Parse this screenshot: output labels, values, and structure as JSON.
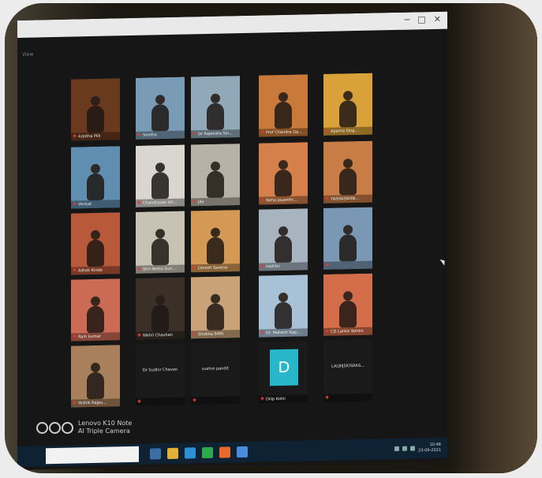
{
  "window": {
    "minimize_glyph": "─",
    "maximize_glyph": "□",
    "close_glyph": "✕",
    "menu_label": "View"
  },
  "participants": [
    {
      "name": "Arpitha Pilli",
      "bg": "#6a3a1e"
    },
    {
      "name": "Smitha",
      "bg": "#7a9bb5"
    },
    {
      "name": "Dr Rajendra Sin...",
      "bg": "#90a8b8"
    },
    {
      "name": "Prof Chandra Ga...",
      "bg": "#c97a3a"
    },
    {
      "name": "Aparna Sing...",
      "bg": "#d9a13a"
    },
    {
      "name": "Venkat",
      "bg": "#5f8eb0"
    },
    {
      "name": "Chandrasan Alt...",
      "bg": "#d8d6cf"
    },
    {
      "name": "Jay",
      "bg": "#b7b2a6"
    },
    {
      "name": "Neha Jayanthi...",
      "bg": "#d5804a"
    },
    {
      "name": "YASHASWINI...",
      "bg": "#c77d45"
    },
    {
      "name": "Ashok Kinde",
      "bg": "#b85a3a"
    },
    {
      "name": "Shri Neela Suri...",
      "bg": "#c8c2b4"
    },
    {
      "name": "Dinesh Saxena",
      "bg": "#d49a55"
    },
    {
      "name": "HARSH",
      "bg": "#a7b4c0"
    },
    {
      "name": "",
      "bg": "#7a98b3"
    },
    {
      "name": "Ram kumar",
      "bg": "#cc6b55"
    },
    {
      "name": "Nikhil Chauhan",
      "bg": "#3a3028"
    },
    {
      "name": "Shobha SHRI",
      "bg": "#c9a278"
    },
    {
      "name": "Dr. Mahesh Kap...",
      "bg": "#a9c1d6"
    },
    {
      "name": "CD Lanka Yamini",
      "bg": "#d46e4a"
    },
    {
      "name": "Yeshik Rajpu...",
      "bg": "#a8805c"
    }
  ],
  "text_tiles": [
    {
      "center": "Dr Sudhir Cheven",
      "name": ""
    },
    {
      "center": "sushm pandit",
      "name": ""
    },
    {
      "center": "",
      "name": "Dilip Kohli",
      "avatar_letter": "D"
    },
    {
      "center": "LALBIJSIOSRAS...",
      "name": ""
    }
  ],
  "taskbar": {
    "clock_time": "10:48",
    "clock_date": "23-09-2021"
  },
  "watermark": {
    "line1": "Lenovo K10 Note",
    "line2": "AI Triple Camera"
  },
  "colors": {
    "screen": "#161616",
    "taskbar": "#0f2233",
    "mic_muted": "#e23b3b",
    "avatar": "#27b7c9"
  }
}
